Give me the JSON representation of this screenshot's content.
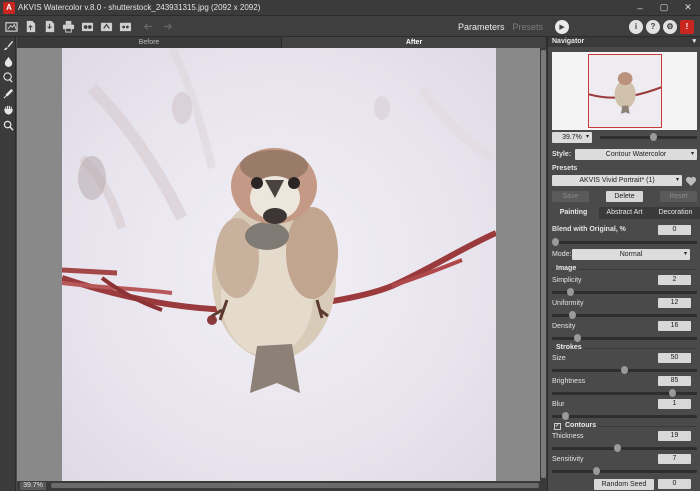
{
  "window": {
    "title": "AKVIS Watercolor v.8.0 - shutterstock_243931315.jpg (2092 x 2092)",
    "logo_letter": "A",
    "controls": [
      "–",
      "▢",
      "✕"
    ]
  },
  "toolbar": {
    "mode_tabs": [
      {
        "label": "Parameters",
        "active": true
      },
      {
        "label": "Presets",
        "active": false
      }
    ],
    "run_icon": "play-icon",
    "right_icons": {
      "info": "i",
      "help": "?",
      "settings": "⚙",
      "akvis": "!"
    }
  },
  "view_tabs": {
    "before": "Before",
    "after": "After"
  },
  "status": {
    "zoom": "39.7%"
  },
  "panel": {
    "navigator_title": "Navigator",
    "zoom_value": "39.7%",
    "zoom_slider": 0.55,
    "style_label": "Style:",
    "style_value": "Contour Watercolor",
    "presets_label": "Presets",
    "preset_value": "AKVIS Vivid Portrait* (1)",
    "buttons": {
      "save": "Save",
      "delete": "Delete",
      "reset": "Reset"
    },
    "tabs": [
      "Painting",
      "Abstract Art",
      "Decoration"
    ],
    "blend_label": "Blend with Original, %",
    "blend_value": "0",
    "blend_slider": 0.0,
    "mode_label": "Mode:",
    "mode_value": "Normal",
    "image_section": "Image",
    "simplicity_label": "Simplicity",
    "simplicity_value": "2",
    "simplicity_slider": 0.11,
    "uniformity_label": "Uniformity",
    "uniformity_value": "12",
    "uniformity_slider": 0.12,
    "density_label": "Density",
    "density_value": "16",
    "density_slider": 0.16,
    "strokes_section": "Strokes",
    "size_label": "Size",
    "size_value": "50",
    "size_slider": 0.5,
    "brightness_label": "Brightness",
    "brightness_value": "85",
    "brightness_slider": 0.85,
    "blur_label": "Blur",
    "blur_value": "1",
    "blur_slider": 0.07,
    "contours_section": "Contours",
    "contours_checked": "✓",
    "thickness_label": "Thickness",
    "thickness_value": "19",
    "thickness_slider": 0.45,
    "sensitivity_label": "Sensitivity",
    "sensitivity_value": "7",
    "sensitivity_slider": 0.3,
    "random_seed_label": "Random Seed",
    "random_seed_value": "0"
  }
}
